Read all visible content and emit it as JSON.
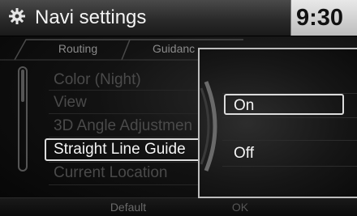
{
  "header": {
    "title": "Navi settings",
    "clock": "9:30",
    "icon": "gear-icon"
  },
  "tabs": [
    {
      "label": "Routing"
    },
    {
      "label": "Guidanc"
    }
  ],
  "settings_list": {
    "items": [
      {
        "label": "Color (Night)",
        "state": "dimmed"
      },
      {
        "label": "View",
        "state": "dimmed"
      },
      {
        "label": "3D Angle Adjustmen",
        "state": "dimmed"
      },
      {
        "label": "Straight Line Guide",
        "state": "selected"
      },
      {
        "label": "Current Location",
        "state": "dimmed"
      }
    ]
  },
  "bottom_bar": {
    "default_label": "Default",
    "ok_label": "OK"
  },
  "popup": {
    "options": [
      {
        "label": "On",
        "selected": true
      },
      {
        "label": "Off",
        "selected": false
      }
    ]
  },
  "colors": {
    "text": "#f4f4f4",
    "dimmed_text": "#4a4a4a",
    "clock_bg": "#d0d0d0"
  }
}
